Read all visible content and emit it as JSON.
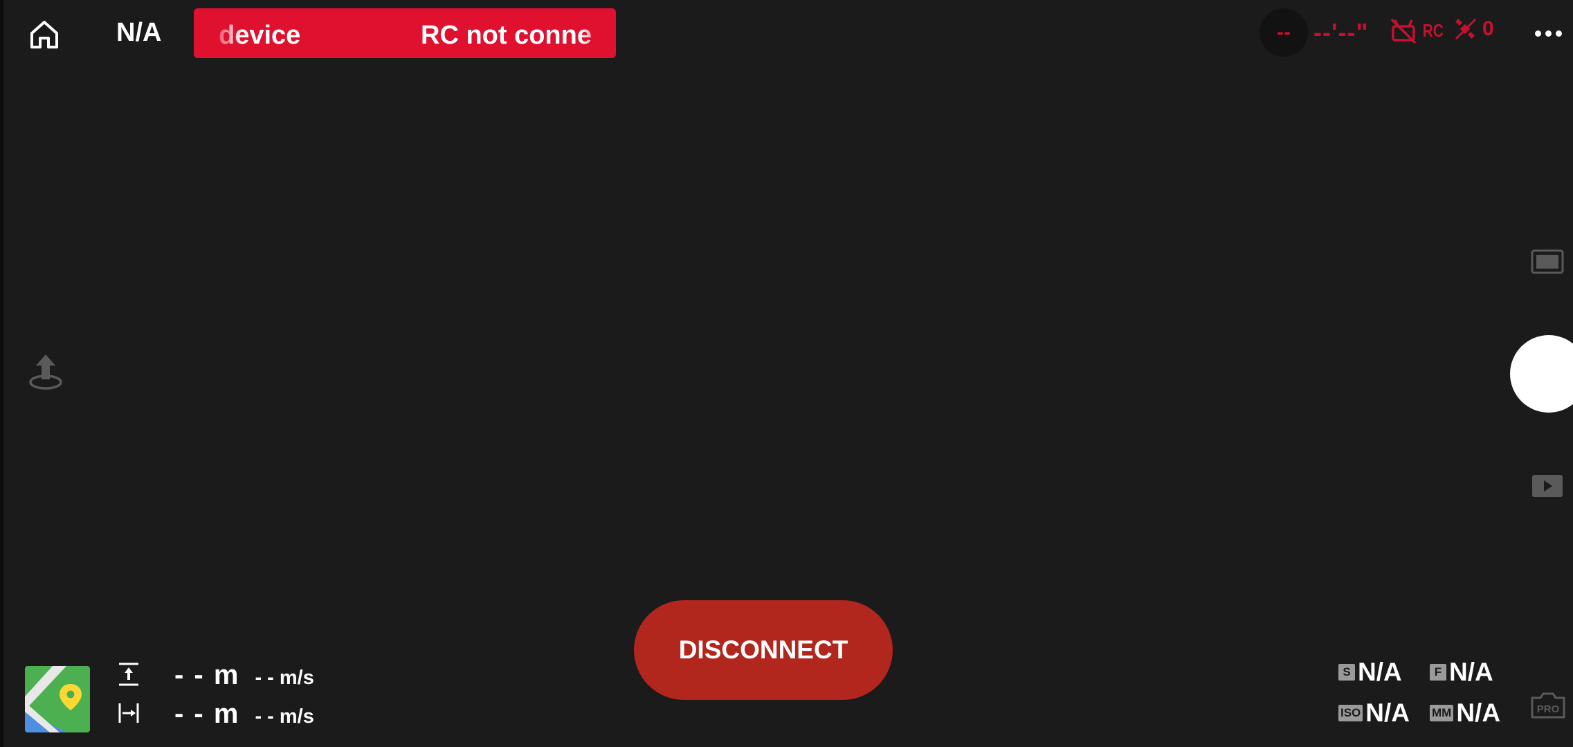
{
  "topbar": {
    "aircraft_status": "N/A",
    "alert_text_1": "device",
    "alert_text_2": "RC not conne",
    "gps_value": "--",
    "flight_time": "--'--\"",
    "rc_label": "RC",
    "satellite_count": "0"
  },
  "left": {
    "takeoff_icon": "takeoff-icon"
  },
  "center": {
    "disconnect_label": "DISCONNECT"
  },
  "telemetry": {
    "altitude_value": "- - m",
    "vertical_speed": "- - m/s",
    "distance_value": "- - m",
    "horizontal_speed": "- - m/s"
  },
  "camera": {
    "shutter_tag": "S",
    "shutter_value": "N/A",
    "aperture_tag": "F",
    "aperture_value": "N/A",
    "iso_tag": "ISO",
    "iso_value": "N/A",
    "focal_tag": "MM",
    "focal_value": "N/A",
    "pro_label": "PRO"
  },
  "colors": {
    "background": "#1b1b1b",
    "alert_red": "#e0102f",
    "status_red": "#c8102e",
    "disconnect_red": "#b1261d"
  }
}
